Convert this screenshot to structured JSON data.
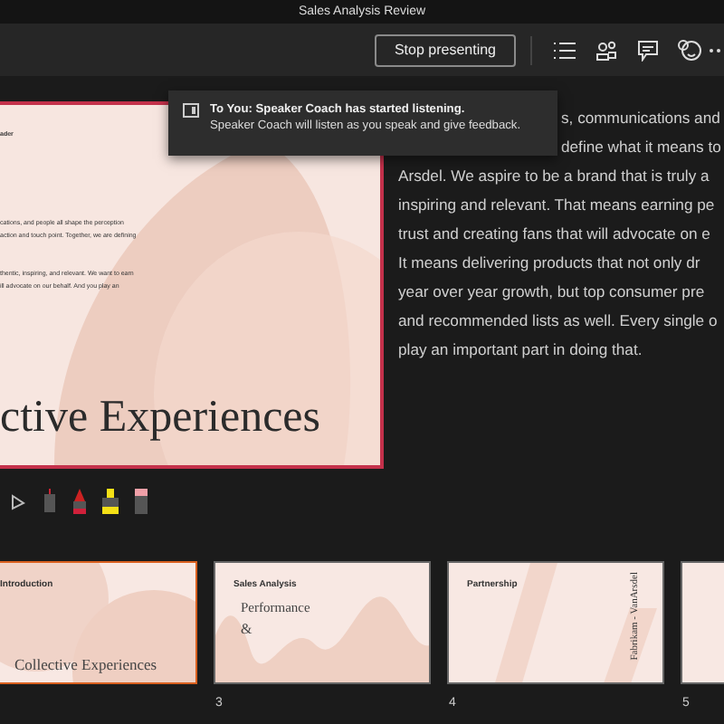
{
  "window": {
    "title": "Sales Analysis Review"
  },
  "toolbar": {
    "stop_button": "Stop presenting"
  },
  "slide": {
    "label": "ader",
    "paragraphs": [
      "cations, and people all shape the perception",
      "action and touch point. Together, we are defining",
      "thentic, inspiring, and relevant. We want to earn",
      "ill advocate on our behalf. And you play an"
    ],
    "heading": "ctive Experiences"
  },
  "notification": {
    "title": "To You: Speaker Coach has started listening.",
    "body": "Speaker Coach will listen as you speak and give feedback."
  },
  "notes": [
    {
      "kind": "partial",
      "text": "s, communications and"
    },
    {
      "kind": "partial",
      "text": "define what it means to"
    },
    {
      "kind": "full",
      "text": "Arsdel. We aspire to be a brand that is truly a"
    },
    {
      "kind": "full",
      "text": "inspiring and relevant. That means earning pe"
    },
    {
      "kind": "full",
      "text": "trust and creating fans that will advocate on e"
    },
    {
      "kind": "full",
      "text": "It means delivering products that not only dr"
    },
    {
      "kind": "full",
      "text": "year over year growth, but top consumer pre"
    },
    {
      "kind": "full",
      "text": "and recommended lists as well. Every single o"
    },
    {
      "kind": "full",
      "text": "play an important part in doing that."
    }
  ],
  "pen_tools": [
    {
      "kind": "pointer",
      "selected": false
    },
    {
      "kind": "pen",
      "selected": false
    },
    {
      "kind": "red-pen",
      "selected": false
    },
    {
      "kind": "highlighter",
      "selected": false
    },
    {
      "kind": "eraser",
      "selected": false
    }
  ],
  "thumbnails": [
    {
      "kind": "intro",
      "selected": true,
      "label": "Introduction",
      "title": "Collective Experiences"
    },
    {
      "kind": "wave",
      "selected": false,
      "number": "3",
      "label": "Sales Analysis",
      "title": "Performance",
      "amp": "&"
    },
    {
      "kind": "vertical",
      "selected": false,
      "number": "4",
      "label": "Partnership",
      "title": "Fabrikam - VanArsdel"
    },
    {
      "kind": "cut",
      "selected": false,
      "number": "5"
    }
  ]
}
